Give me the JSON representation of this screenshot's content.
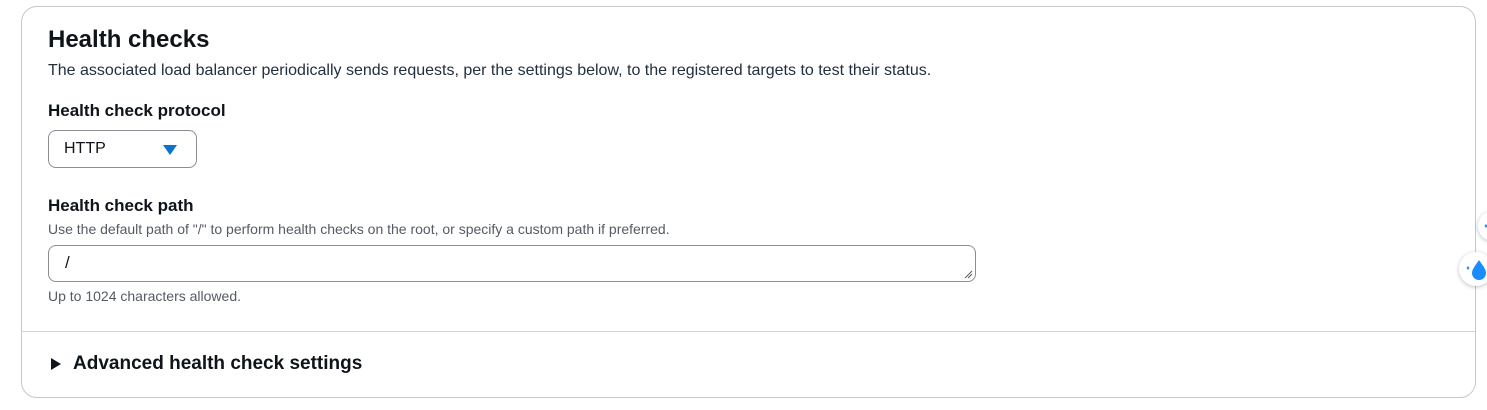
{
  "section": {
    "title": "Health checks",
    "description": "The associated load balancer periodically sends requests, per the settings below, to the registered targets to test their status."
  },
  "protocol": {
    "label": "Health check protocol",
    "selected": "HTTP"
  },
  "path": {
    "label": "Health check path",
    "help": "Use the default path of \"/\" to perform health checks on the root, or specify a custom path if preferred.",
    "value": "/",
    "constraint": "Up to 1024 characters allowed."
  },
  "advanced": {
    "label": "Advanced health check settings",
    "expanded": false
  },
  "colors": {
    "accent": "#0972d3",
    "border": "#8c8c94",
    "text": "#0f141a"
  },
  "icons": {
    "dropdown": "caret-down-icon",
    "expander": "caret-right-icon",
    "side_widget": "sparkle-drop-icon"
  }
}
